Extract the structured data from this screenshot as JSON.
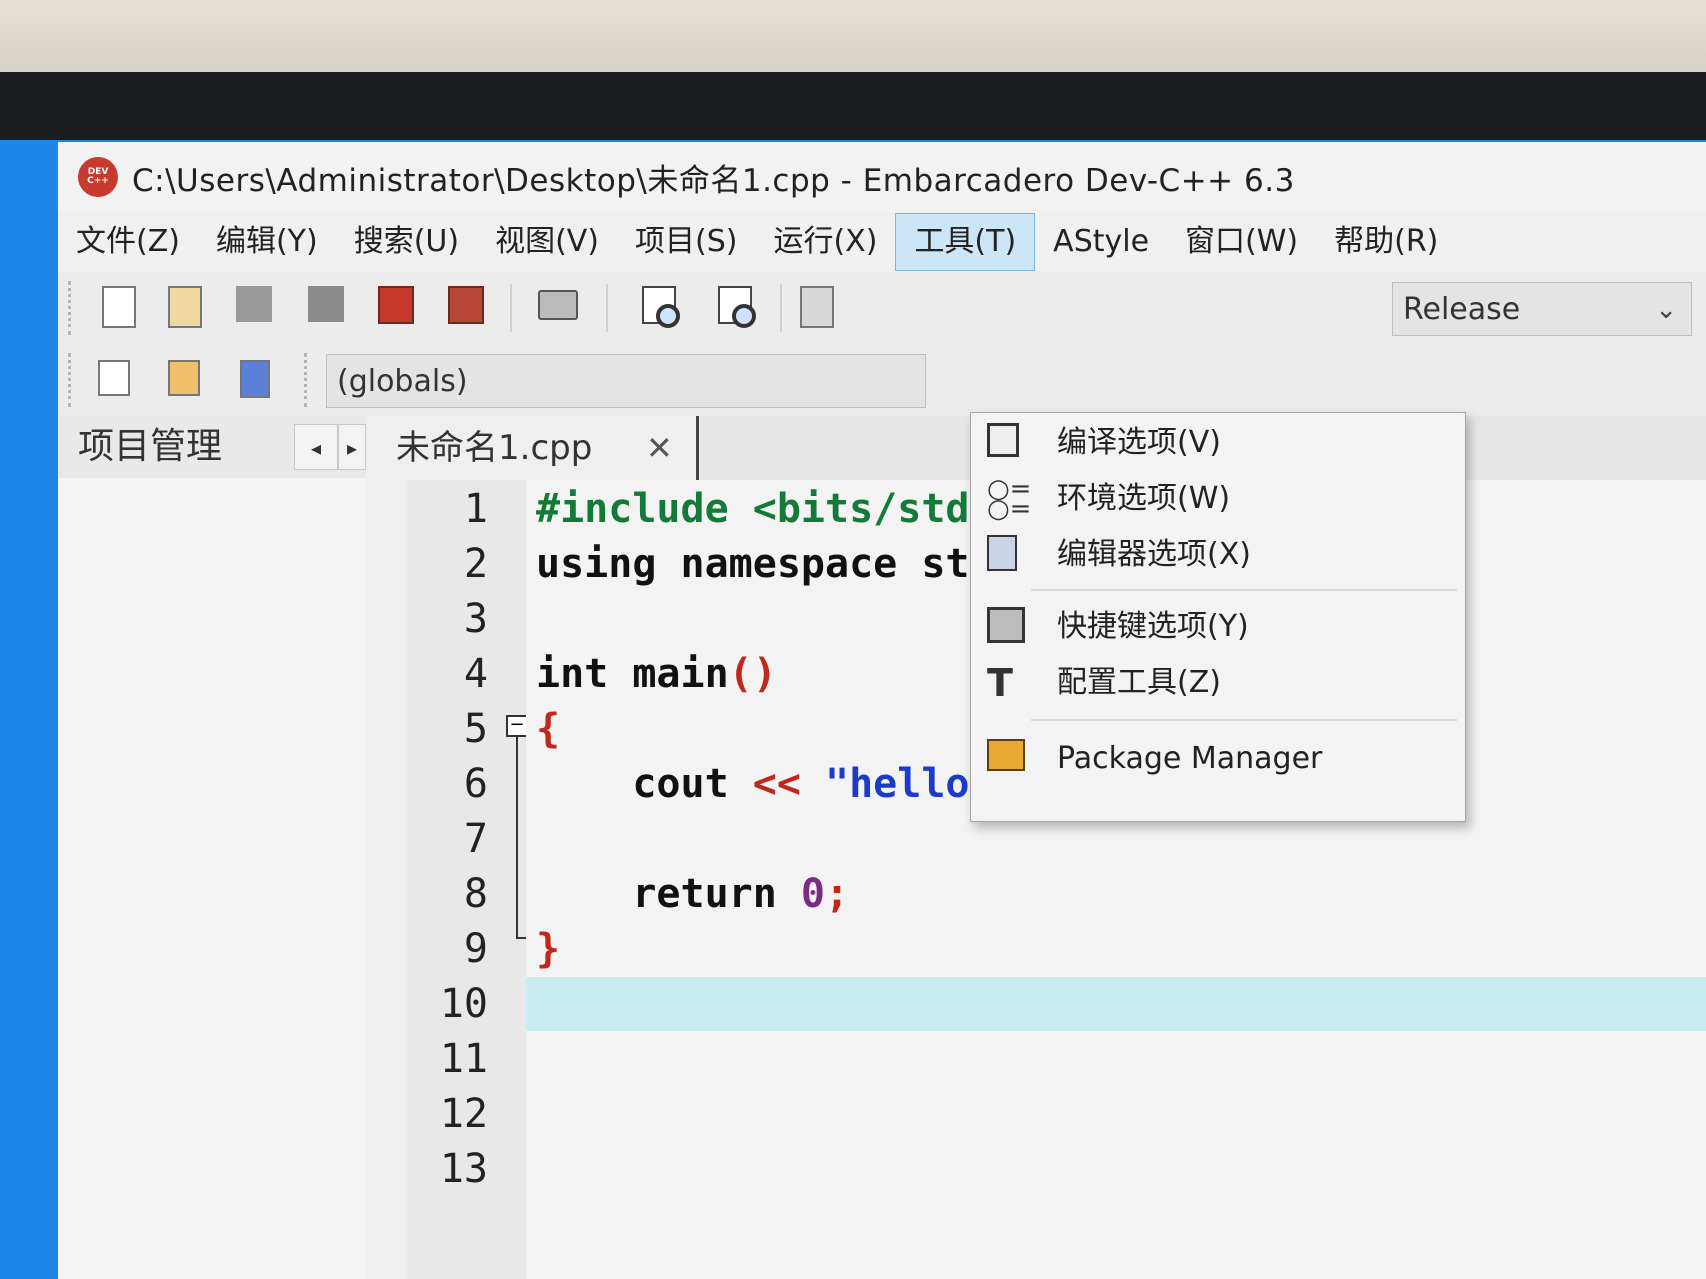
{
  "window": {
    "title": "C:\\Users\\Administrator\\Desktop\\未命名1.cpp - Embarcadero Dev-C++ 6.3",
    "logo_text": "DEV C++"
  },
  "menubar": {
    "items": [
      "文件(Z)",
      "编辑(Y)",
      "搜索(U)",
      "视图(V)",
      "项目(S)",
      "运行(X)",
      "工具(T)",
      "AStyle",
      "窗口(W)",
      "帮助(R)"
    ],
    "active_index": 6
  },
  "toolbar": {
    "compiler_combo": "Release",
    "globals_combo": "(globals)"
  },
  "left_panel": {
    "tab_label": "项目管理",
    "prev_icon": "◂",
    "next_icon": "▸"
  },
  "editor": {
    "file_tab": "未命名1.cpp",
    "close_glyph": "✕",
    "line_numbers": [
      "1",
      "2",
      "3",
      "4",
      "5",
      "6",
      "7",
      "8",
      "9",
      "10",
      "11",
      "12",
      "13"
    ],
    "current_line": 10
  },
  "tools_menu": {
    "items": [
      {
        "label": "编译选项(V)",
        "icon": "compiler-options-icon"
      },
      {
        "label": "环境选项(W)",
        "icon": "environment-options-icon"
      },
      {
        "label": "编辑器选项(X)",
        "icon": "editor-options-icon"
      },
      {
        "label": "快捷键选项(Y)",
        "icon": "shortcut-options-icon"
      },
      {
        "label": "配置工具(Z)",
        "icon": "hammer-icon"
      },
      {
        "label": "Package Manager",
        "icon": "package-icon"
      }
    ]
  },
  "colors": {
    "preprocessor": "#137b37",
    "symbol": "#c0281c",
    "string": "#1c3cc8",
    "number": "#7b2a86",
    "current_line_bg": "#c9ecf0",
    "active_menu_bg": "#cde6f7"
  }
}
